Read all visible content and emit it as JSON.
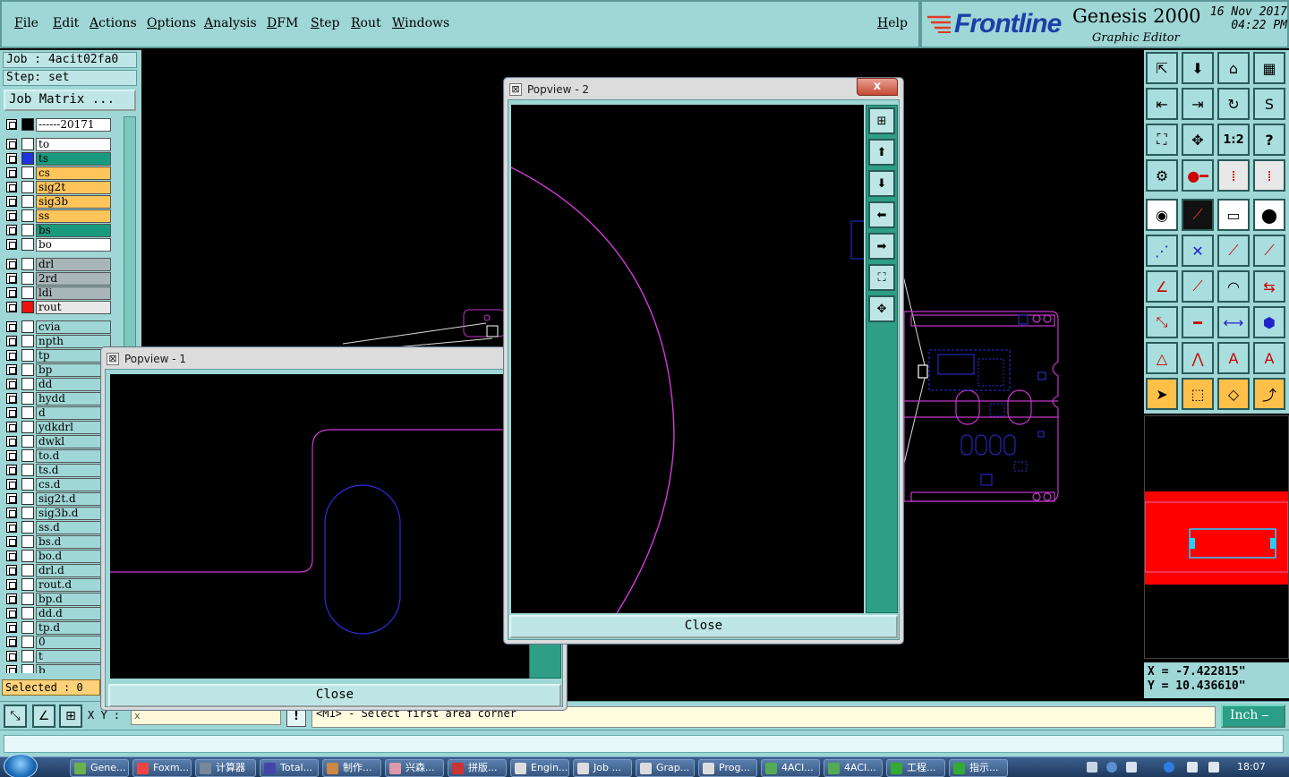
{
  "menubar": {
    "items": [
      "File",
      "Edit",
      "Actions",
      "Options",
      "Analysis",
      "DFM",
      "Step",
      "Rout",
      "Windows"
    ],
    "help": "Help"
  },
  "brand": {
    "logo": "Frontline",
    "product": "Genesis 2000",
    "subtitle": "Graphic Editor",
    "date": "16 Nov 2017",
    "time": "04:22 PM"
  },
  "leftpanel": {
    "job": "Job : 4acit02fa0",
    "step": "Step: set",
    "job_matrix": "Job Matrix ...",
    "selected": "Selected : 0",
    "layers": [
      {
        "name": "------20171",
        "bg": "#ffffff",
        "swatch": "#000000"
      },
      {
        "name": "to",
        "bg": "#ffffff",
        "swatch": "#ffffff"
      },
      {
        "name": "ts",
        "bg": "#1a9a7c",
        "swatch": "#2233dd"
      },
      {
        "name": "cs",
        "bg": "#ffc45a",
        "swatch": "#ffffff"
      },
      {
        "name": "sig2t",
        "bg": "#ffc45a",
        "swatch": "#ffffff"
      },
      {
        "name": "sig3b",
        "bg": "#ffc45a",
        "swatch": "#ffffff"
      },
      {
        "name": "ss",
        "bg": "#ffc45a",
        "swatch": "#ffffff"
      },
      {
        "name": "bs",
        "bg": "#1a9a7c",
        "swatch": "#ffffff"
      },
      {
        "name": "bo",
        "bg": "#ffffff",
        "swatch": "#ffffff"
      },
      {
        "name": "drl",
        "bg": "#a9b6b9",
        "swatch": "#ffffff"
      },
      {
        "name": "2rd",
        "bg": "#a9b6b9",
        "swatch": "#ffffff"
      },
      {
        "name": "ldi",
        "bg": "#a9b6b9",
        "swatch": "#ffffff"
      },
      {
        "name": "rout",
        "bg": "#e8e8e8",
        "swatch": "#ee1111"
      },
      {
        "name": "cvia",
        "bg": "#9fd6d6",
        "swatch": "#ffffff"
      },
      {
        "name": "npth",
        "bg": "#9fd6d6",
        "swatch": "#ffffff"
      },
      {
        "name": "tp",
        "bg": "#9fd6d6",
        "swatch": "#ffffff"
      },
      {
        "name": "bp",
        "bg": "#9fd6d6",
        "swatch": "#ffffff"
      },
      {
        "name": "dd",
        "bg": "#9fd6d6",
        "swatch": "#ffffff"
      },
      {
        "name": "hydd",
        "bg": "#9fd6d6",
        "swatch": "#ffffff"
      },
      {
        "name": "d",
        "bg": "#9fd6d6",
        "swatch": "#ffffff"
      },
      {
        "name": "ydkdrl",
        "bg": "#9fd6d6",
        "swatch": "#ffffff"
      },
      {
        "name": "dwkl",
        "bg": "#9fd6d6",
        "swatch": "#ffffff"
      },
      {
        "name": "to.d",
        "bg": "#9fd6d6",
        "swatch": "#ffffff"
      },
      {
        "name": "ts.d",
        "bg": "#9fd6d6",
        "swatch": "#ffffff"
      },
      {
        "name": "cs.d",
        "bg": "#9fd6d6",
        "swatch": "#ffffff"
      },
      {
        "name": "sig2t.d",
        "bg": "#9fd6d6",
        "swatch": "#ffffff"
      },
      {
        "name": "sig3b.d",
        "bg": "#9fd6d6",
        "swatch": "#ffffff"
      },
      {
        "name": "ss.d",
        "bg": "#9fd6d6",
        "swatch": "#ffffff"
      },
      {
        "name": "bs.d",
        "bg": "#9fd6d6",
        "swatch": "#ffffff"
      },
      {
        "name": "bo.d",
        "bg": "#9fd6d6",
        "swatch": "#ffffff"
      },
      {
        "name": "drl.d",
        "bg": "#9fd6d6",
        "swatch": "#ffffff"
      },
      {
        "name": "rout.d",
        "bg": "#9fd6d6",
        "swatch": "#ffffff"
      },
      {
        "name": "bp.d",
        "bg": "#9fd6d6",
        "swatch": "#ffffff"
      },
      {
        "name": "dd.d",
        "bg": "#9fd6d6",
        "swatch": "#ffffff"
      },
      {
        "name": "tp.d",
        "bg": "#9fd6d6",
        "swatch": "#ffffff"
      },
      {
        "name": "0",
        "bg": "#9fd6d6",
        "swatch": "#ffffff"
      },
      {
        "name": "t",
        "bg": "#9fd6d6",
        "swatch": "#ffffff"
      },
      {
        "name": "b",
        "bg": "#9fd6d6",
        "swatch": "#ffffff"
      }
    ]
  },
  "righttoolbar": {
    "zoom_ratio_label": "1:2",
    "help_label": "?"
  },
  "coords": {
    "x": "X = -7.422815\"",
    "y": "Y = 10.436610\""
  },
  "bottombar": {
    "xy_label": "X Y :",
    "xy_value": "x",
    "excl": "!",
    "prompt": "<M1> - Select first area corner",
    "unit": "Inch"
  },
  "popview1": {
    "title": "Popview - 1",
    "close_label": "Close",
    "close_x": "x"
  },
  "popview2": {
    "title": "Popview - 2",
    "close_label": "Close",
    "close_x": "x"
  },
  "taskbar": {
    "items": [
      "Gene...",
      "Foxm...",
      "计算器",
      "Total...",
      "制作...",
      "兴森...",
      "拼版...",
      "Engin...",
      "Job ...",
      "Grap...",
      "Prog...",
      "4ACI...",
      "4ACI...",
      "工程...",
      "指示..."
    ],
    "clock": "18:07"
  },
  "colors": {
    "panel": "#9fd6d6",
    "outline_magenta": "#d23ad8",
    "outline_blue": "#2d2ee0",
    "overview_red": "#ff0000"
  }
}
